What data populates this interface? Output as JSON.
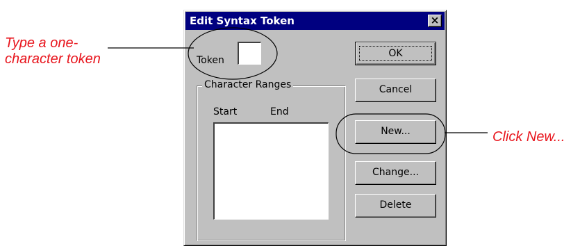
{
  "dialog": {
    "title": "Edit Syntax Token",
    "close_symbol": "×",
    "token_label": "Token",
    "token_value": "",
    "group_title": "Character Ranges",
    "columns": [
      "Start",
      "End"
    ],
    "buttons": {
      "ok": "OK",
      "cancel": "Cancel",
      "new": "New...",
      "change": "Change...",
      "delete": "Delete"
    }
  },
  "annotations": {
    "token_callout": [
      "Type a one-",
      "character token"
    ],
    "new_callout": "Click New..."
  },
  "colors": {
    "annotation": "#e8141c",
    "titlebar": "#000080",
    "dialog_face": "#c0c0c0"
  }
}
